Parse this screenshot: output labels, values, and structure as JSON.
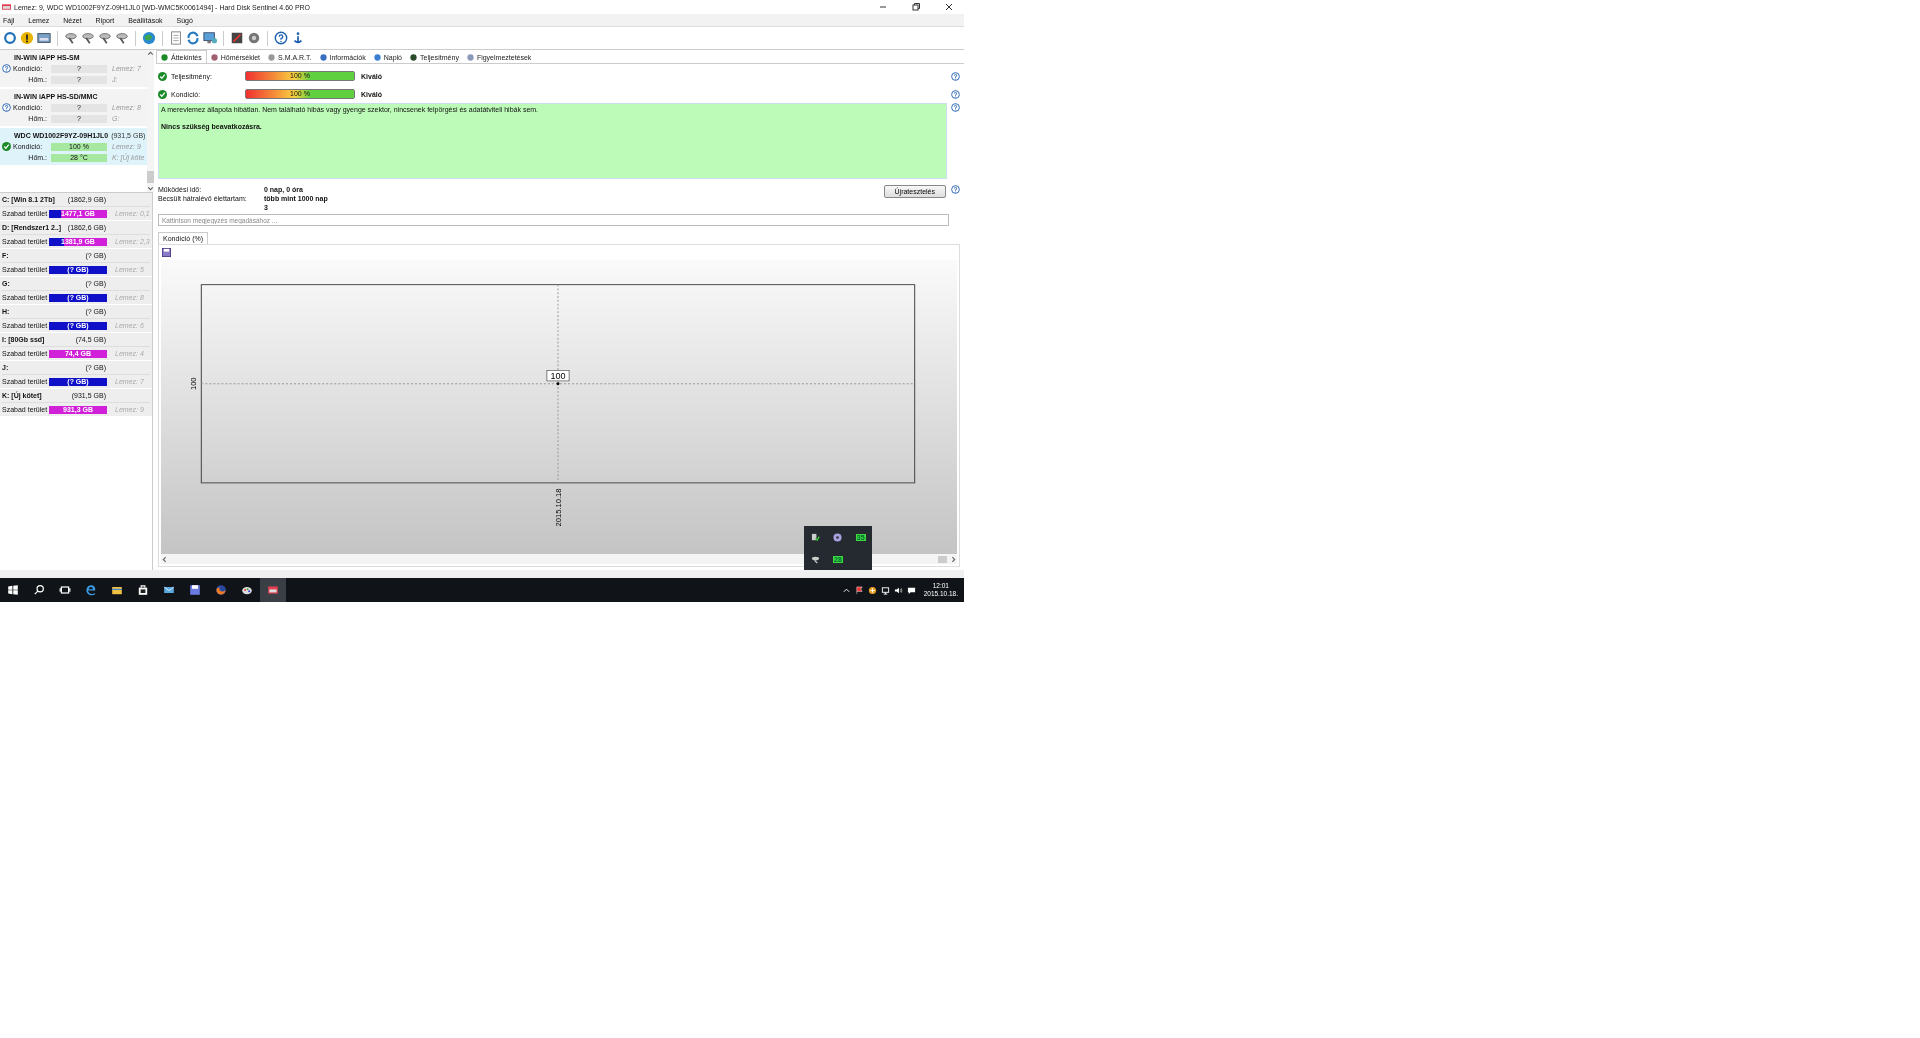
{
  "window": {
    "title": "Lemez: 9, WDC WD1002F9YZ-09H1JL0 [WD-WMC5K0061494]  -  Hard Disk Sentinel 4.60 PRO"
  },
  "menu": [
    "Fájl",
    "Lemez",
    "Nézet",
    "Riport",
    "Beállítások",
    "Súgó"
  ],
  "disks": [
    {
      "name": "IN-WIN iAPP HS-SM",
      "kind": "unknown",
      "selected": false,
      "condition_label": "Kondíció:",
      "condition": {
        "value": "?",
        "level": 0
      },
      "temp_label": "Hőm.:",
      "temperature": {
        "value": "?",
        "level": 0
      },
      "disk_no": "Lemez: 7",
      "drive": "J:"
    },
    {
      "name": "IN-WIN iAPP HS-SD/MMC",
      "kind": "unknown",
      "selected": false,
      "condition_label": "Kondíció:",
      "condition": {
        "value": "?",
        "level": 0
      },
      "temp_label": "Hőm.:",
      "temperature": {
        "value": "?",
        "level": 0
      },
      "disk_no": "Lemez: 8",
      "drive": "G:"
    },
    {
      "name": "WDC WD1002F9YZ-09H1JL0",
      "size": "(931,5 GB)",
      "kind": "ok",
      "selected": true,
      "condition_label": "Kondíció:",
      "condition": {
        "value": "100 %",
        "level": 1
      },
      "temp_label": "Hőm.:",
      "temperature": {
        "value": "28 °C",
        "level": 1
      },
      "disk_no": "Lemez: 9",
      "drive": "K: [Új köte"
    }
  ],
  "volumes": [
    {
      "name": "C: [Win 8.1 2Tb]",
      "size": "(1862,9 GB)",
      "free_label": "Szabad terület",
      "free": {
        "value": "1477,1 GB",
        "level": 0.79
      },
      "disk": "Lemez: 0,1"
    },
    {
      "name": "D: [Rendszer1 2..]",
      "size": "(1862,6 GB)",
      "free_label": "Szabad terület",
      "free": {
        "value": "1381,9 GB",
        "level": 0.74
      },
      "disk": "Lemez: 2,3"
    },
    {
      "name": "F:",
      "size": "(? GB)",
      "free_label": "Szabad terület",
      "free": {
        "value": "(? GB)",
        "level": 0
      },
      "disk": "Lemez: 5"
    },
    {
      "name": "G:",
      "size": "(? GB)",
      "free_label": "Szabad terület",
      "free": {
        "value": "(? GB)",
        "level": 0
      },
      "disk": "Lemez: 8"
    },
    {
      "name": "H:",
      "size": "(? GB)",
      "free_label": "Szabad terület",
      "free": {
        "value": "(? GB)",
        "level": 0
      },
      "disk": "Lemez: 6"
    },
    {
      "name": "I: [80Gb ssd]",
      "size": "(74,5 GB)",
      "free_label": "Szabad terület",
      "free": {
        "value": "74,4 GB",
        "level": 1
      },
      "disk": "Lemez: 4"
    },
    {
      "name": "J:",
      "size": "(? GB)",
      "free_label": "Szabad terület",
      "free": {
        "value": "(? GB)",
        "level": 0
      },
      "disk": "Lemez: 7"
    },
    {
      "name": "K: [Új kötet]",
      "size": "(931,5 GB)",
      "free_label": "Szabad terület",
      "free": {
        "value": "931,3 GB",
        "level": 1
      },
      "disk": "Lemez: 9"
    }
  ],
  "tabs": [
    {
      "label": "Áttekintés",
      "selected": true
    },
    {
      "label": "Hőmérséklet",
      "selected": false
    },
    {
      "label": "S.M.A.R.T.",
      "selected": false
    },
    {
      "label": "Információk",
      "selected": false
    },
    {
      "label": "Napló",
      "selected": false
    },
    {
      "label": "Teljesítmény",
      "selected": false
    },
    {
      "label": "Figyelmeztetések",
      "selected": false
    }
  ],
  "ratings": [
    {
      "label": "Teljesítmény:",
      "value": "100 %",
      "level": 1,
      "rating": "Kiváló"
    },
    {
      "label": "Kondíció:",
      "value": "100 %",
      "level": 1,
      "rating": "Kiváló"
    }
  ],
  "message": {
    "text": "A merevlemez állapota hibátlan. Nem található hibás vagy gyenge szektor, nincsenek felpörgési és adatátviteli hibák sem.",
    "action": "Nincs szükség beavatkozásra."
  },
  "info": [
    {
      "label": "Működési idő:",
      "value": "0 nap, 0 óra"
    },
    {
      "label": "Becsült hátralévő élettartam:",
      "value": "több mint 1000 nap"
    }
  ],
  "info_note": "3",
  "retest_button": "Újratesztelés",
  "note_field": {
    "placeholder": "Kattintson megjegyzés megadásához ..."
  },
  "chart_tabs": [
    {
      "label": "Kondíció  (%)",
      "selected": true
    }
  ],
  "chart": {
    "y_axis_mark": "100",
    "x_axis_mark": "2015.10.18",
    "point_label": "100"
  },
  "tray_popup": [
    "35",
    "28"
  ],
  "clock": {
    "time": "12:01",
    "date": "2015.10.18."
  }
}
